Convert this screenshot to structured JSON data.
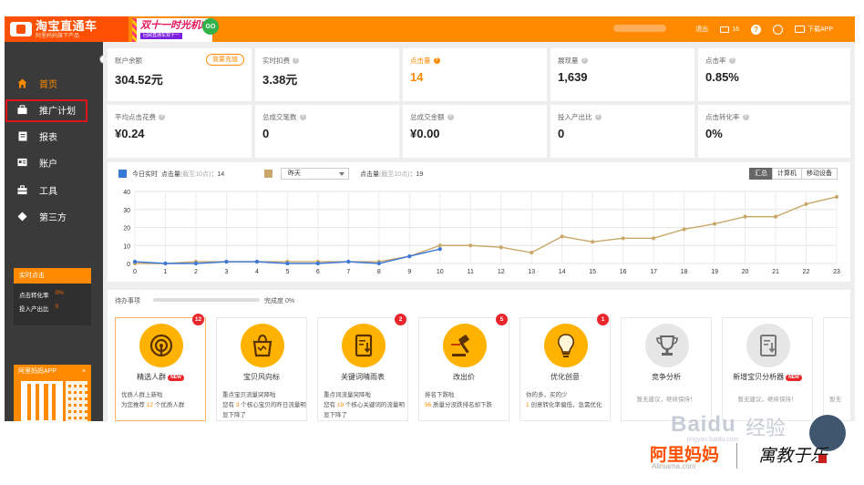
{
  "header": {
    "logo_title": "淘宝直通车",
    "logo_subtitle": "阿里妈妈旗下产品",
    "promo_title": "双十一时光机!",
    "promo_small": "回顾直通车双十一",
    "promo_go": "GO",
    "user_name": "",
    "logout": "退出",
    "messages_count": "16",
    "download": "下载APP",
    "brand_color": "#ff8a00"
  },
  "sidebar": {
    "items": [
      {
        "label": "首页",
        "icon": "home-icon",
        "active": true
      },
      {
        "label": "推广计划",
        "icon": "campaign-icon"
      },
      {
        "label": "报表",
        "icon": "report-icon"
      },
      {
        "label": "账户",
        "icon": "account-icon"
      },
      {
        "label": "工具",
        "icon": "tools-icon"
      },
      {
        "label": "第三方",
        "icon": "thirdparty-icon"
      }
    ],
    "realtime": {
      "title": "实时点击",
      "ctr_label": "点击转化率",
      "ctr_value": "0%",
      "roi_label": "投入产出比",
      "roi_value": "0"
    },
    "app": {
      "title": "阿里妈妈APP",
      "close": "×"
    }
  },
  "stats": {
    "balance_label": "账户余额",
    "balance_value": "304.52元",
    "recharge": "我要充值",
    "spend_label": "实时扣费",
    "spend_value": "3.38元",
    "clicks_label": "点击量",
    "clicks_value": "14",
    "impressions_label": "展现量",
    "impressions_value": "1,639",
    "ctr_label": "点击率",
    "ctr_value": "0.85%",
    "cpc_label": "平均点击花费",
    "cpc_value": "¥0.24",
    "orders_label": "总成交笔数",
    "orders_value": "0",
    "gmv_label": "总成交金额",
    "gmv_value": "¥0.00",
    "roi_label": "投入产出比",
    "roi_value": "0",
    "cvr_label": "点击转化率",
    "cvr_value": "0%"
  },
  "chart_panel": {
    "today_label": "今日实时",
    "today_metric": "点击量",
    "today_note": "(截至10点)",
    "today_total": "：14",
    "compare_select": "昨天",
    "compare_metric": "点击量",
    "compare_note": "(截至10点)",
    "compare_total": "：19",
    "tabs": [
      "汇总",
      "计算机",
      "移动设备"
    ],
    "active_tab": "汇总",
    "today_color": "#3a78d8",
    "compare_color": "#c9a86a"
  },
  "chart_data": {
    "type": "line",
    "x": [
      0,
      1,
      2,
      3,
      4,
      5,
      6,
      7,
      8,
      9,
      10,
      11,
      12,
      13,
      14,
      15,
      16,
      17,
      18,
      19,
      20,
      21,
      22,
      23
    ],
    "ylim": [
      0,
      40
    ],
    "yticks": [
      0,
      10,
      20,
      30,
      40
    ],
    "grid": true,
    "series": [
      {
        "name": "今日实时",
        "values": [
          1,
          0,
          0,
          1,
          1,
          0,
          0,
          1,
          0,
          4,
          8
        ]
      },
      {
        "name": "昨天",
        "values": [
          0,
          0,
          1,
          1,
          1,
          1,
          1,
          1,
          1,
          4,
          10,
          10,
          9,
          6,
          15,
          12,
          14,
          14,
          19,
          22,
          26,
          26,
          33,
          37
        ]
      }
    ]
  },
  "todo": {
    "title": "待办事项",
    "progress_label": "完成度 0%",
    "progress_value": 0,
    "tools": [
      {
        "name": "精选人群",
        "badge": "12",
        "new": "NEW",
        "desc_a": "优质人群上新啦",
        "desc_b": "为您推荐",
        "desc_hl": "12",
        "desc_c": "个优质人群"
      },
      {
        "name": "宝贝风向标",
        "badge": "",
        "desc_a": "重点宝贝流量突降啦",
        "desc_b": "您有",
        "desc_hl": "3",
        "desc_c": "个核心宝贝的昨日流量明显下降了"
      },
      {
        "name": "关键词晴雨表",
        "badge": "2",
        "desc_a": "重点词流量突降啦",
        "desc_b": "您有",
        "desc_hl": "19",
        "desc_c": "个核心关键词的流量明显下降了"
      },
      {
        "name": "改出价",
        "badge": "5",
        "desc_a": "排名下跌啦",
        "desc_b": "",
        "desc_hl": "96",
        "desc_c": "质量分没跌排名却下跌"
      },
      {
        "name": "优化创意",
        "badge": "1",
        "desc_a": "你的多，买的少",
        "desc_b": "",
        "desc_hl": "1",
        "desc_c": "创意转化率偏低，急需优化"
      },
      {
        "name": "竞争分析",
        "badge": "",
        "desc_a": "暂无建议，继续保持！"
      },
      {
        "name": "新增宝贝分析器",
        "badge": "",
        "new": "NEW",
        "desc_a": "暂无建议，继续保持！"
      },
      {
        "name": "",
        "badge": "",
        "desc_a": "暂无"
      }
    ]
  },
  "watermark": {
    "baidu": "Baidu",
    "baidu_sub": "经验",
    "baidu_url": "jingyan.baidu.com",
    "ali": "阿里妈妈",
    "ali_url": "Alimama.com",
    "sign": "寓教于乐"
  }
}
